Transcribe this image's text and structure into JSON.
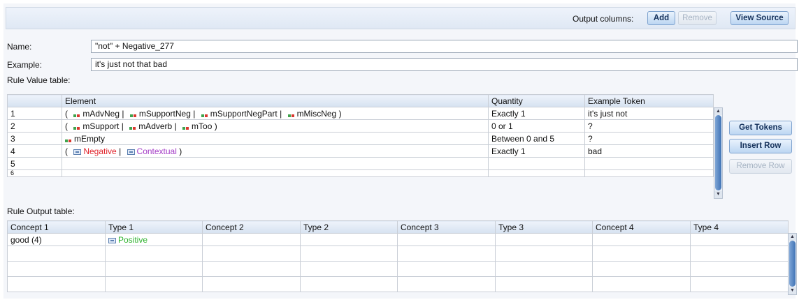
{
  "toolbar": {
    "output_columns_label": "Output columns:",
    "add_label": "Add",
    "remove_label": "Remove",
    "view_source_label": "View Source"
  },
  "form": {
    "name_label": "Name:",
    "name_value": "\"not\" + Negative_277",
    "example_label": "Example:",
    "example_value": "it's just not that bad"
  },
  "rule_value_table": {
    "title": "Rule Value table:",
    "headers": [
      "Element",
      "Quantity",
      "Example Token"
    ],
    "rows": [
      {
        "num": "1",
        "element_parts": [
          "(",
          "mAdvNeg",
          "|",
          "mSupportNeg",
          "|",
          "mSupportNegPart",
          "|",
          "mMiscNeg",
          ")"
        ],
        "quantity": "Exactly 1",
        "token": "it's just not"
      },
      {
        "num": "2",
        "element_parts": [
          "(",
          "mSupport",
          "|",
          "mAdverb",
          "|",
          "mToo",
          ")"
        ],
        "quantity": "0 or 1",
        "token": "?"
      },
      {
        "num": "3",
        "element_parts": [
          "mEmpty"
        ],
        "quantity": "Between 0 and 5",
        "token": "?"
      },
      {
        "num": "4",
        "element_parts": [
          "(",
          "Negative",
          "|",
          "Contextual",
          ")"
        ],
        "quantity": "Exactly 1",
        "token": "bad"
      },
      {
        "num": "5",
        "quantity": "",
        "token": ""
      },
      {
        "num": "6",
        "quantity": "",
        "token": ""
      }
    ]
  },
  "side_buttons": {
    "get_tokens": "Get Tokens",
    "insert_row": "Insert Row",
    "remove_row": "Remove Row"
  },
  "rule_output_table": {
    "title": "Rule Output table:",
    "headers": [
      "Concept 1",
      "Type 1",
      "Concept 2",
      "Type 2",
      "Concept 3",
      "Type 3",
      "Concept 4",
      "Type 4"
    ],
    "rows": [
      {
        "concept1": "good  (4)",
        "type1": "Positive"
      }
    ]
  },
  "colors": {
    "negative": "#e0232b",
    "contextual": "#a43ec7",
    "positive": "#2fb32f",
    "button_primary": "#bcd6f2"
  },
  "icons": [
    "macro-chip-icon",
    "concept-type-icon"
  ]
}
